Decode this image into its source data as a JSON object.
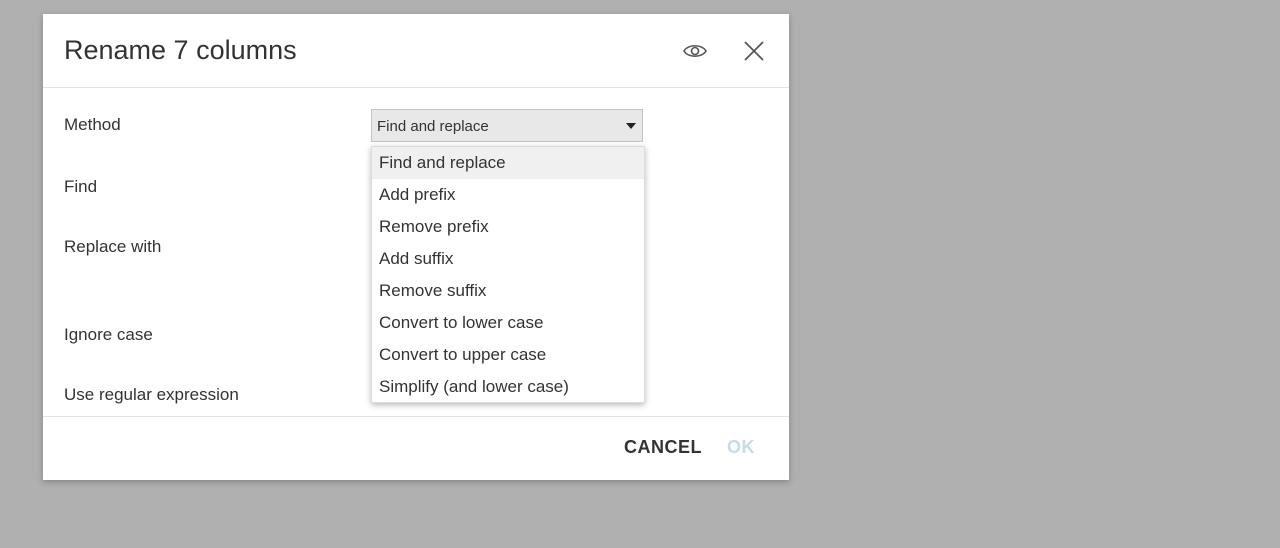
{
  "dialog": {
    "title": "Rename 7 columns",
    "icons": {
      "preview": "eye-icon",
      "close": "close-icon"
    }
  },
  "form": {
    "method_label": "Method",
    "find_label": "Find",
    "replace_label": "Replace with",
    "ignore_case_label": "Ignore case",
    "regex_label": "Use regular expression"
  },
  "method_select": {
    "value": "Find and replace",
    "options": [
      "Find and replace",
      "Add prefix",
      "Remove prefix",
      "Add suffix",
      "Remove suffix",
      "Convert to lower case",
      "Convert to upper case",
      "Simplify (and lower case)"
    ]
  },
  "footer": {
    "cancel_label": "CANCEL",
    "ok_label": "OK"
  },
  "colors": {
    "backdrop": "#b0b0b0",
    "ok_disabled": "#c5dbea",
    "text": "#333333"
  }
}
